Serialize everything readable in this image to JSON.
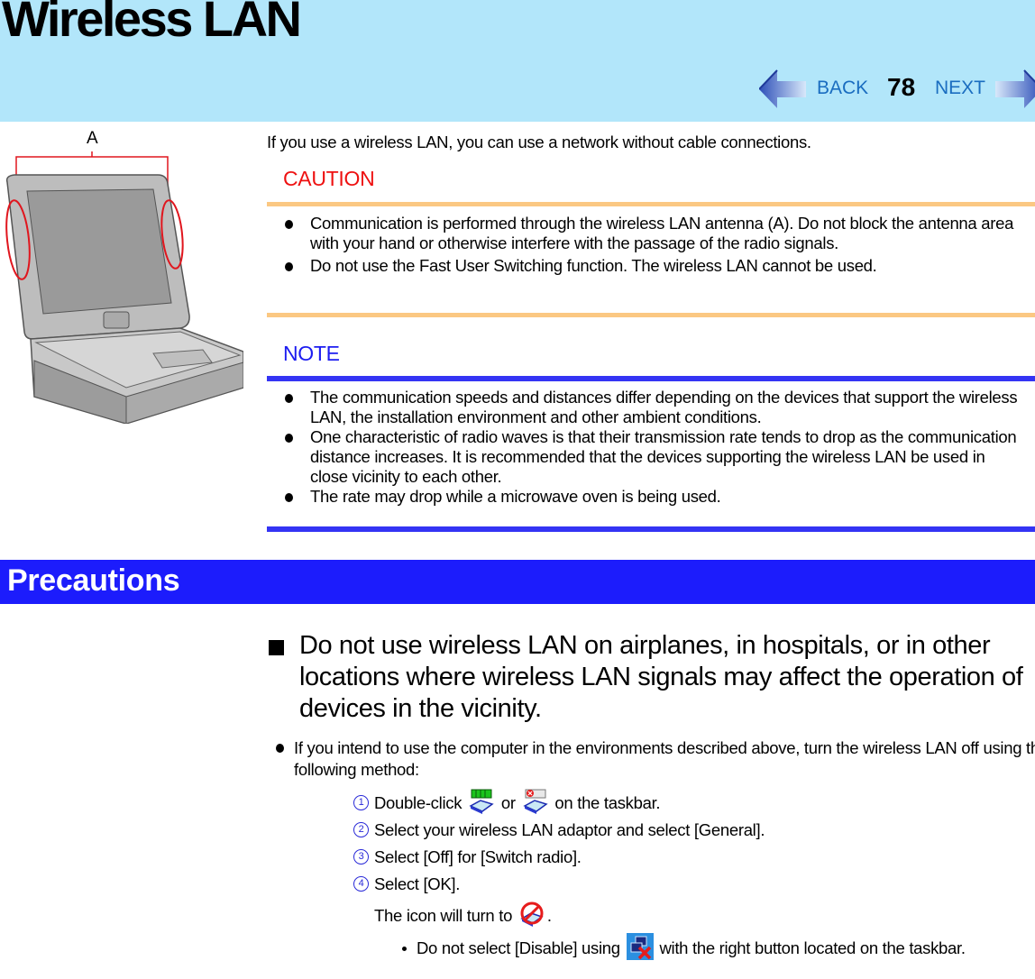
{
  "header": {
    "title": "Wireless LAN",
    "nav": {
      "back_label": "BACK",
      "page_number": "78",
      "next_label": "NEXT",
      "back_icon": "left-arrow-icon",
      "next_icon": "right-arrow-icon"
    }
  },
  "figure": {
    "label": "A",
    "description": "Laptop computer with wireless LAN antenna areas circled in red on both sides of the display",
    "accent_color": "#e0161e"
  },
  "intro": "If you use a wireless LAN, you can use a network without cable connections.",
  "caution": {
    "title": "CAUTION",
    "color": "#ee1111",
    "rule_color": "#fbc882",
    "items": [
      "Communication is performed through the wireless LAN antenna (A).  Do not block the antenna area with your hand or otherwise interfere with the passage of the radio signals.",
      "Do not use the Fast User Switching function. The wireless LAN cannot be used."
    ]
  },
  "note": {
    "title": "NOTE",
    "color": "#1c1cf0",
    "rule_color": "#3434f4",
    "items": [
      "The communication speeds and distances differ depending on the devices that support the wireless LAN, the installation environment and other ambient conditions.",
      "One characteristic of radio waves is that their transmission rate tends to drop as the communication distance increases.  It is recommended that the devices supporting the wireless LAN be used in close vicinity to each other.",
      "The rate may drop while a microwave oven is being used."
    ]
  },
  "precautions": {
    "title": "Precautions",
    "bar_color": "#1c1cfc",
    "warning": "Do not use wireless LAN on airplanes, in hospitals, or in other locations where wireless LAN signals may affect the operation of devices in the vicinity.",
    "instruction": "If you intend to use the computer in the environments described above, turn the wireless LAN off using the following method:",
    "steps": [
      {
        "num": "1",
        "before": "Double-click",
        "icon1": "wireless-connected-tray-icon",
        "mid": "or",
        "icon2": "wireless-disconnected-tray-icon",
        "after": "on the taskbar."
      },
      {
        "num": "2",
        "text": "Select your wireless LAN adaptor and select [General]."
      },
      {
        "num": "3",
        "text": "Select [Off] for [Switch radio]."
      },
      {
        "num": "4",
        "text": "Select [OK]."
      }
    ],
    "result_before": "The icon will turn to",
    "result_icon": "wireless-off-icon",
    "result_after": ".",
    "sub_note_before": "Do not select [Disable] using",
    "sub_note_icon": "network-disabled-icon",
    "sub_note_after": "with the right button located on the taskbar."
  }
}
